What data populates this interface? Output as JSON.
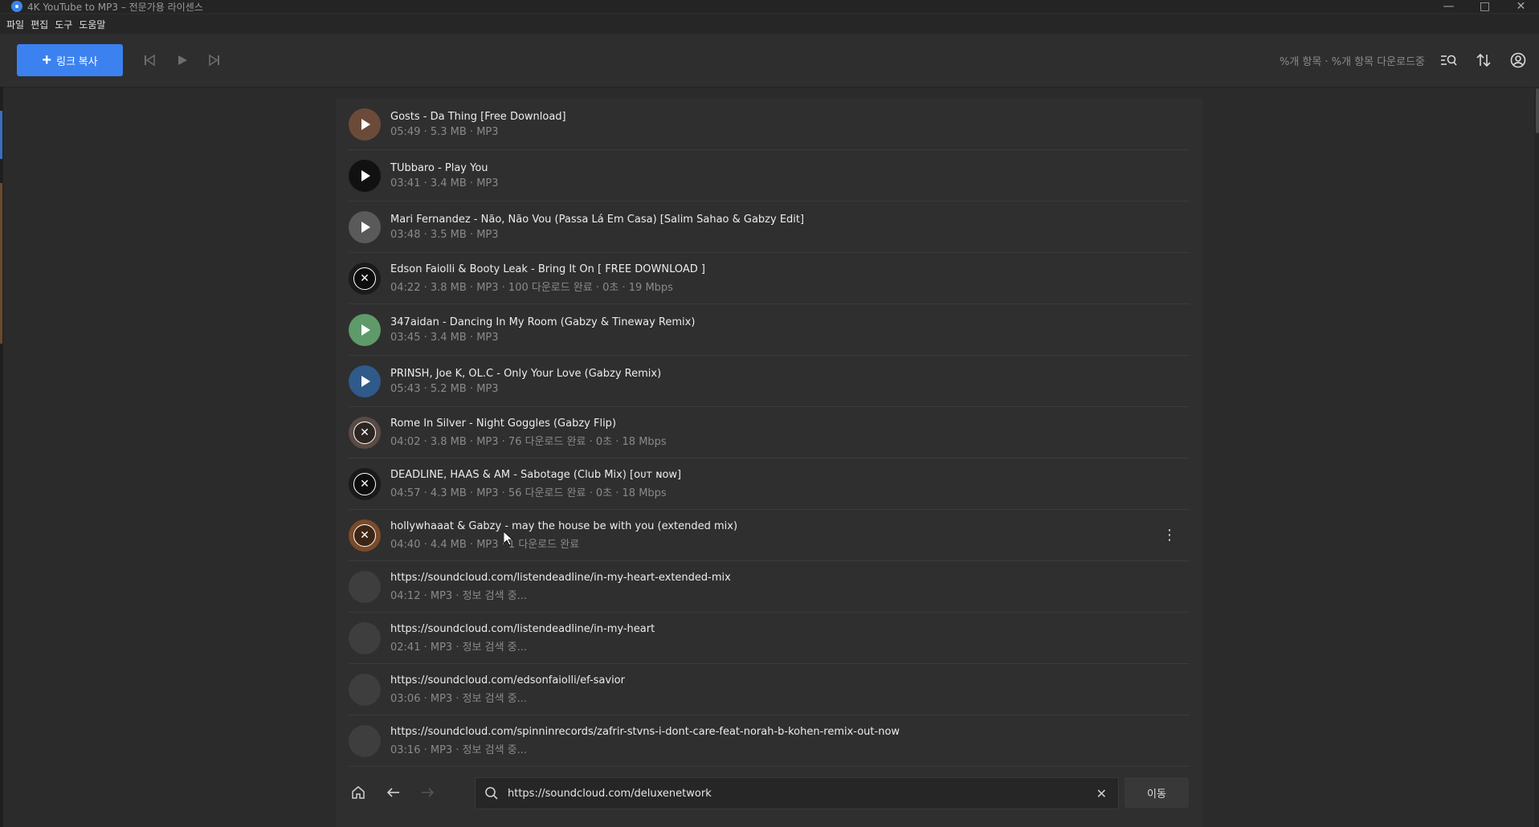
{
  "window": {
    "title": "4K YouTube to MP3 – 전문가용 라이센스"
  },
  "menu": [
    "파일",
    "편집",
    "도구",
    "도움말"
  ],
  "toolbar": {
    "paste_link_label": "링크 복사",
    "status_text": "%개 항목 · %개 항목 다운로드중"
  },
  "items": [
    {
      "title": "Gosts - Da Thing [Free Download]",
      "meta": "05:49 · 5.3 MB · MP3",
      "thumb": "#6b4a3a",
      "state": "play"
    },
    {
      "title": "TUbbaro - Play You",
      "meta": "03:41 · 3.4 MB · MP3",
      "thumb": "#111111",
      "state": "play"
    },
    {
      "title": "Mari Fernandez - Não, Não Vou (Passa Lá Em Casa) [Salim Sahao & Gabzy Edit]",
      "meta": "03:48 · 3.5 MB · MP3",
      "thumb": "#5a5a5a",
      "state": "play"
    },
    {
      "title": "Edson Faiolli & Booty Leak - Bring It On [ FREE DOWNLOAD ]",
      "meta": "04:22 · 3.8 MB · MP3 · 100 다운로드 완료 · 0초 · 19 Mbps",
      "thumb": "#1a1a1a",
      "state": "cancel"
    },
    {
      "title": "347aidan - Dancing In My Room (Gabzy & Tineway Remix)",
      "meta": "03:45 · 3.4 MB · MP3",
      "thumb": "#5f9a6a",
      "state": "play"
    },
    {
      "title": "PRINSH, Joe K, OL.C - Only Your Love (Gabzy Remix)",
      "meta": "05:43 · 5.2 MB · MP3",
      "thumb": "#2f5a8a",
      "state": "play"
    },
    {
      "title": "Rome In Silver - Night Goggles (Gabzy Flip)",
      "meta": "04:02 · 3.8 MB · MP3 · 76 다운로드 완료 · 0초 · 18 Mbps",
      "thumb": "#5a4a44",
      "state": "cancel"
    },
    {
      "title": "DEADLINE, HAAS & AM - Sabotage (Club Mix) [ᴏᴜᴛ ɴᴏᴡ]",
      "meta": "04:57 · 4.3 MB · MP3 · 56 다운로드 완료 · 0초 · 18 Mbps",
      "thumb": "#1a1a1a",
      "state": "cancel"
    },
    {
      "title": "hollywhaaat & Gabzy - may the house be with you (extended mix)",
      "meta": "04:40 · 4.4 MB · MP3 · 1 다운로드 완료",
      "thumb": "#7a4a2a",
      "state": "cancel",
      "menu": true
    },
    {
      "title": "https://soundcloud.com/listendeadline/in-my-heart-extended-mix",
      "meta": "04:12 · MP3 · 정보 검색 중...",
      "thumb": "",
      "state": "blank"
    },
    {
      "title": "https://soundcloud.com/listendeadline/in-my-heart",
      "meta": "02:41 · MP3 · 정보 검색 중...",
      "thumb": "",
      "state": "blank"
    },
    {
      "title": "https://soundcloud.com/edsonfaiolli/ef-savior",
      "meta": "03:06 · MP3 · 정보 검색 중...",
      "thumb": "",
      "state": "blank"
    },
    {
      "title": "https://soundcloud.com/spinninrecords/zafrir-stvns-i-dont-care-feat-norah-b-kohen-remix-out-now",
      "meta": "03:16 · MP3 · 정보 검색 중...",
      "thumb": "",
      "state": "blank"
    }
  ],
  "browser": {
    "url": "https://soundcloud.com/deluxenetwork",
    "go_label": "이동"
  },
  "colors": {
    "accent": "#3b82f0",
    "background": "#2b2b2b",
    "panel": "#2f2f2f"
  }
}
